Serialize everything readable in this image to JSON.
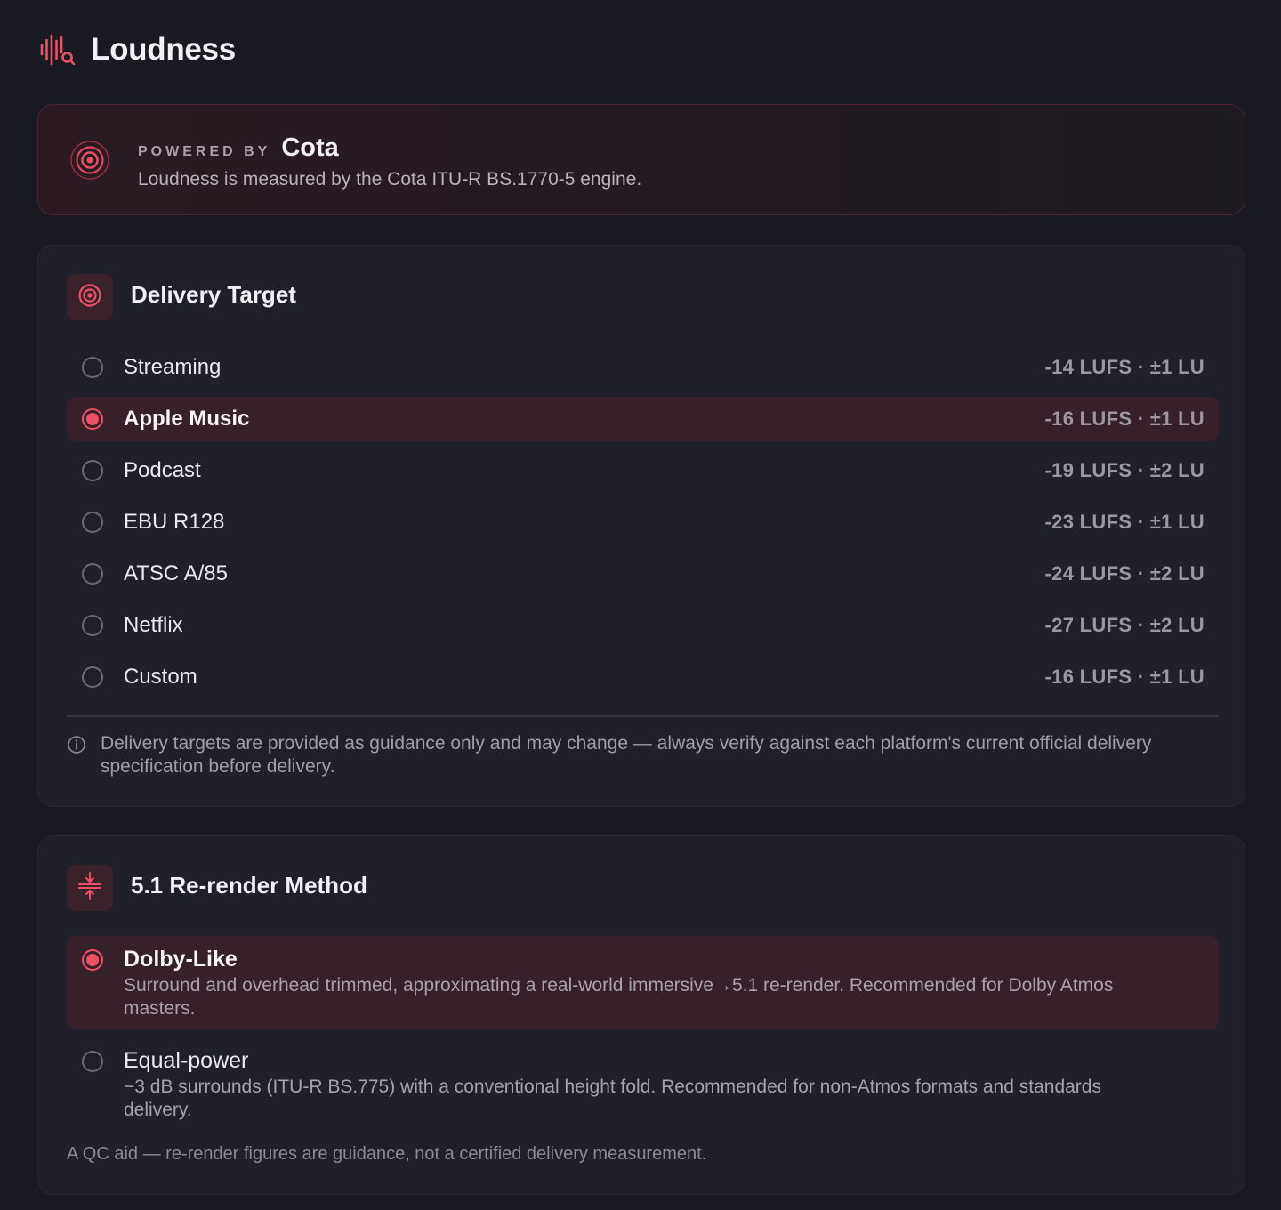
{
  "header": {
    "title": "Loudness",
    "icon": "waveform-search-icon"
  },
  "banner": {
    "powered_by": "POWERED BY",
    "brand": "Cota",
    "description": "Loudness is measured by the Cota ITU-R BS.1770-5 engine.",
    "icon": "target-icon"
  },
  "delivery": {
    "title": "Delivery Target",
    "icon": "target-icon",
    "options": [
      {
        "label": "Streaming",
        "value": "-14 LUFS · ±1 LU",
        "selected": false
      },
      {
        "label": "Apple Music",
        "value": "-16 LUFS · ±1 LU",
        "selected": true
      },
      {
        "label": "Podcast",
        "value": "-19 LUFS · ±2 LU",
        "selected": false
      },
      {
        "label": "EBU R128",
        "value": "-23 LUFS · ±1 LU",
        "selected": false
      },
      {
        "label": "ATSC A/85",
        "value": "-24 LUFS · ±2 LU",
        "selected": false
      },
      {
        "label": "Netflix",
        "value": "-27 LUFS · ±2 LU",
        "selected": false
      },
      {
        "label": "Custom",
        "value": "-16 LUFS · ±1 LU",
        "selected": false
      }
    ],
    "note": "Delivery targets are provided as guidance only and may change — always verify against each platform's current official delivery specification before delivery."
  },
  "rerender": {
    "title": "5.1 Re-render Method",
    "icon": "compress-vertical-icon",
    "options": [
      {
        "label": "Dolby-Like",
        "description": "Surround and overhead trimmed, approximating a real-world immersive→5.1 re-render. Recommended for Dolby Atmos masters.",
        "selected": true
      },
      {
        "label": "Equal-power",
        "description": "−3 dB surrounds (ITU-R BS.775) with a conventional height fold. Recommended for non-Atmos formats and standards delivery.",
        "selected": false
      }
    ],
    "footnote": "A QC aid — re-render figures are guidance, not a certified delivery measurement."
  },
  "colors": {
    "accent": "#ef5065",
    "background": "#1a1b22",
    "card": "#1f2029",
    "selected_row": "#362029"
  }
}
